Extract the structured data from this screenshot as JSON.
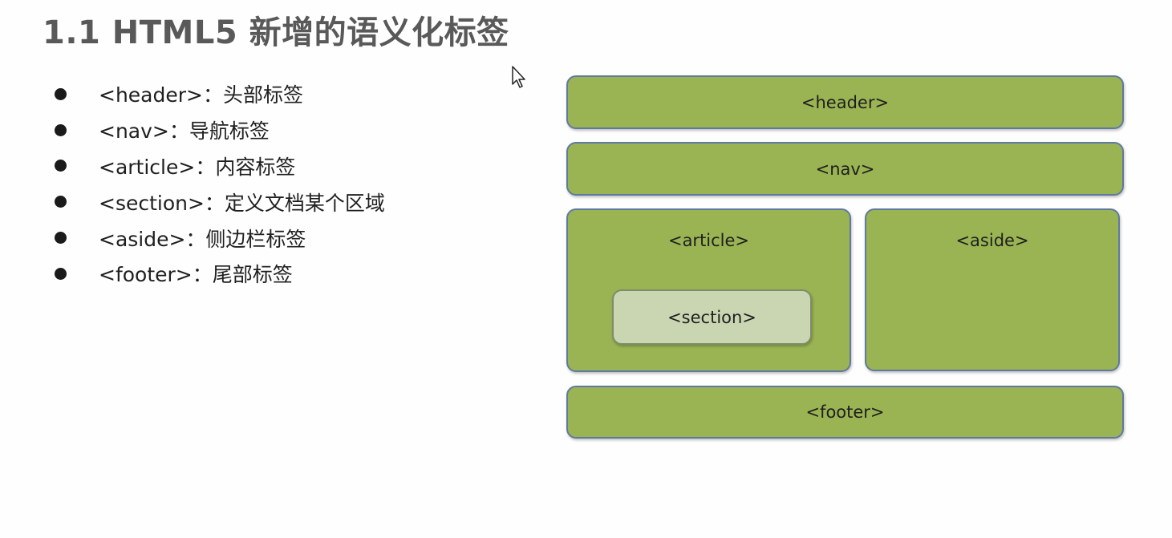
{
  "title": "1.1 HTML5 新增的语义化标签",
  "bullets": [
    {
      "text": "<header>：头部标签"
    },
    {
      "text": "<nav>：导航标签"
    },
    {
      "text": "<article>：内容标签"
    },
    {
      "text": "<section>：定义文档某个区域"
    },
    {
      "text": "<aside>：侧边栏标签"
    },
    {
      "text": "<footer>：尾部标签"
    }
  ],
  "diagram": {
    "header": "<header>",
    "nav": "<nav>",
    "article": "<article>",
    "section": "<section>",
    "aside": "<aside>",
    "footer": "<footer>"
  },
  "colors": {
    "box_fill": "#9bb453",
    "box_border": "#5f7aa0",
    "section_fill": "#cad6b2",
    "title_text": "#595959"
  },
  "icons": {
    "cursor": "mouse-pointer-icon"
  }
}
